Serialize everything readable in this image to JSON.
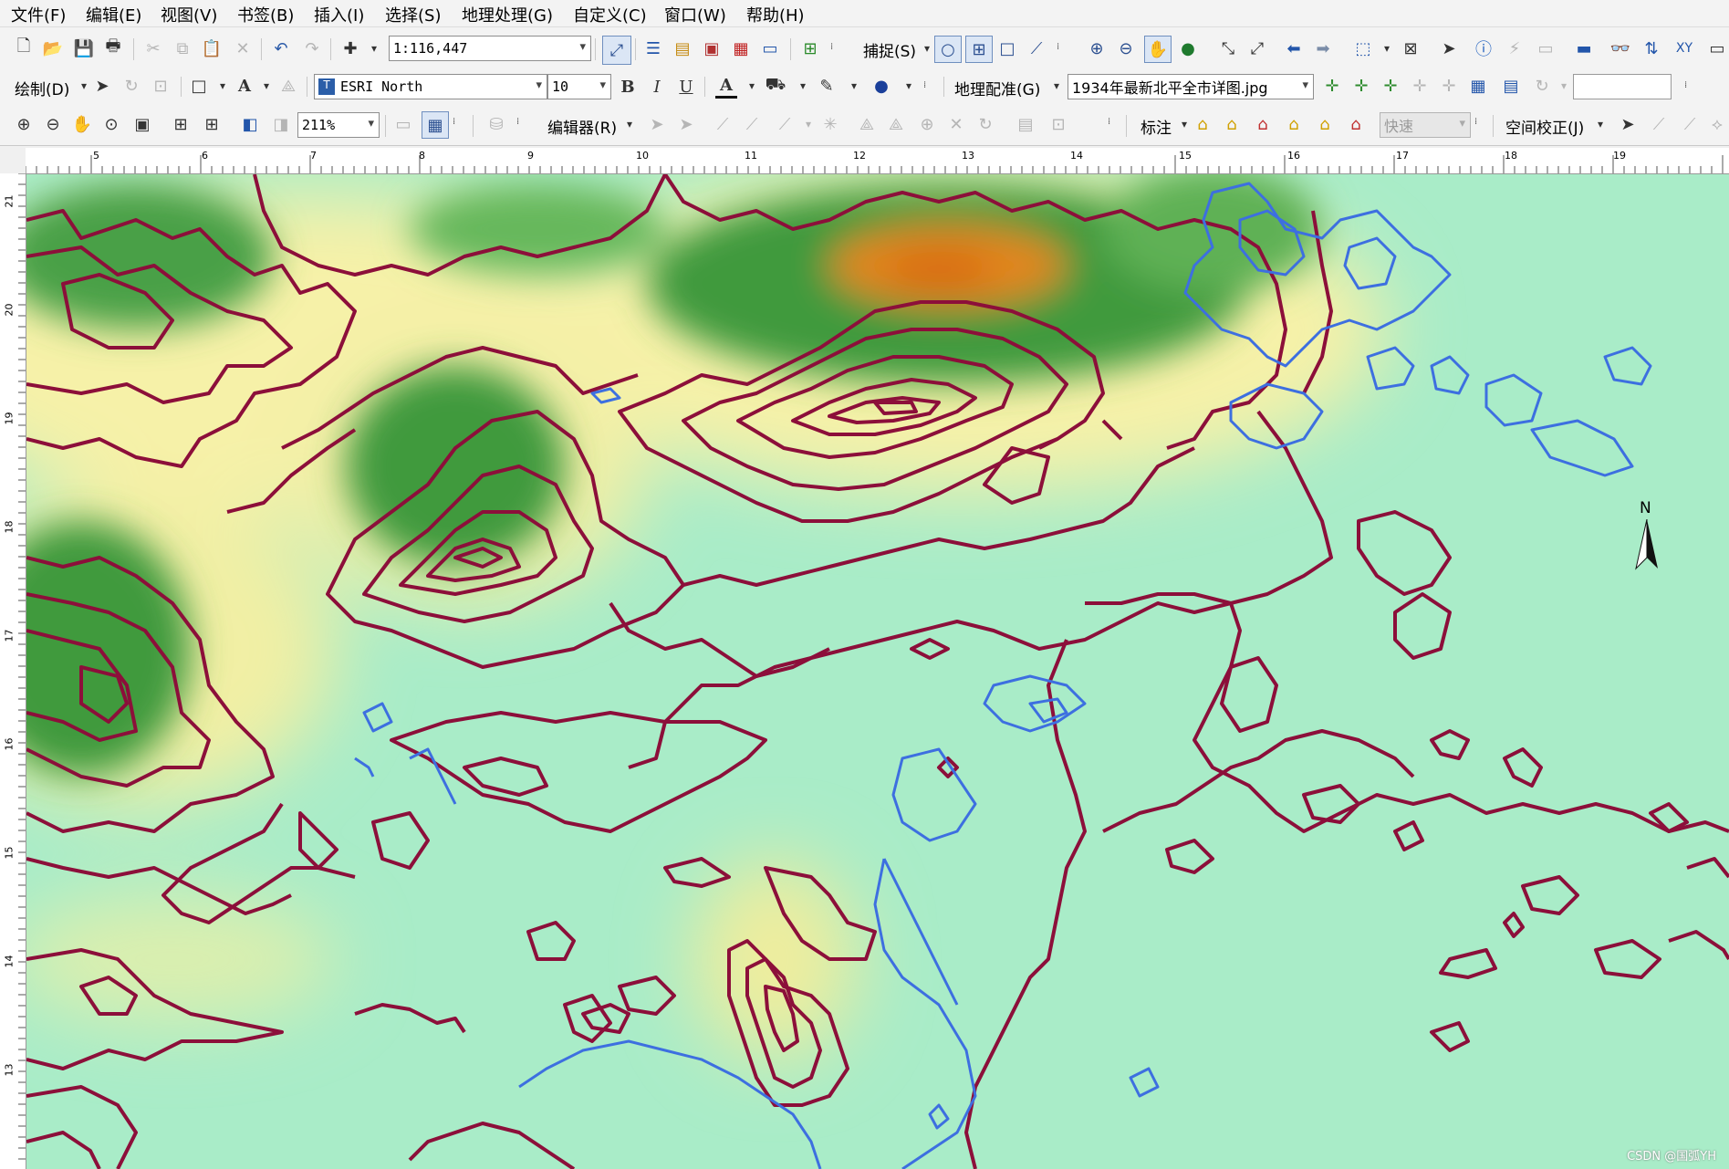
{
  "menubar": [
    "文件(F)",
    "编辑(E)",
    "视图(V)",
    "书签(B)",
    "插入(I)",
    "选择(S)",
    "地理处理(G)",
    "自定义(C)",
    "窗口(W)",
    "帮助(H)"
  ],
  "toolbar1": {
    "scale_value": "1:116,447",
    "snapping_label": "捕捉(S)"
  },
  "toolbar2": {
    "drawing_label": "绘制(D)",
    "font_name": "ESRI North",
    "font_size": "10",
    "bold": "B",
    "italic": "I",
    "underline": "U",
    "font_color_glyph": "A",
    "georeferencing_label": "地理配准(G)",
    "layer_value": "1934年最新北平全市详图.jpg"
  },
  "toolbar3": {
    "zoom_value": "211%",
    "editor_label": "编辑器(R)",
    "labeling_label": "标注",
    "labeling_mode": "快速",
    "spatial_adjustment_label": "空间校正(J)"
  },
  "ruler_top_labels": [
    "5",
    "6",
    "7",
    "8",
    "9",
    "10",
    "11",
    "12",
    "13",
    "14",
    "15",
    "16",
    "17",
    "18",
    "19"
  ],
  "ruler_left_labels": [
    "21",
    "20",
    "19",
    "18",
    "17",
    "16",
    "15",
    "14",
    "13"
  ],
  "map": {
    "north_arrow_letter": "N",
    "colors": {
      "contour": "#8c0f3a",
      "water": "#3d6fe0",
      "lowland": "#a9ecc8",
      "highland_green": "#3f9a3c",
      "highland_yellow": "#f6f1a8",
      "peak_orange": "#e2861a"
    }
  },
  "watermark": "CSDN @国弧YH"
}
